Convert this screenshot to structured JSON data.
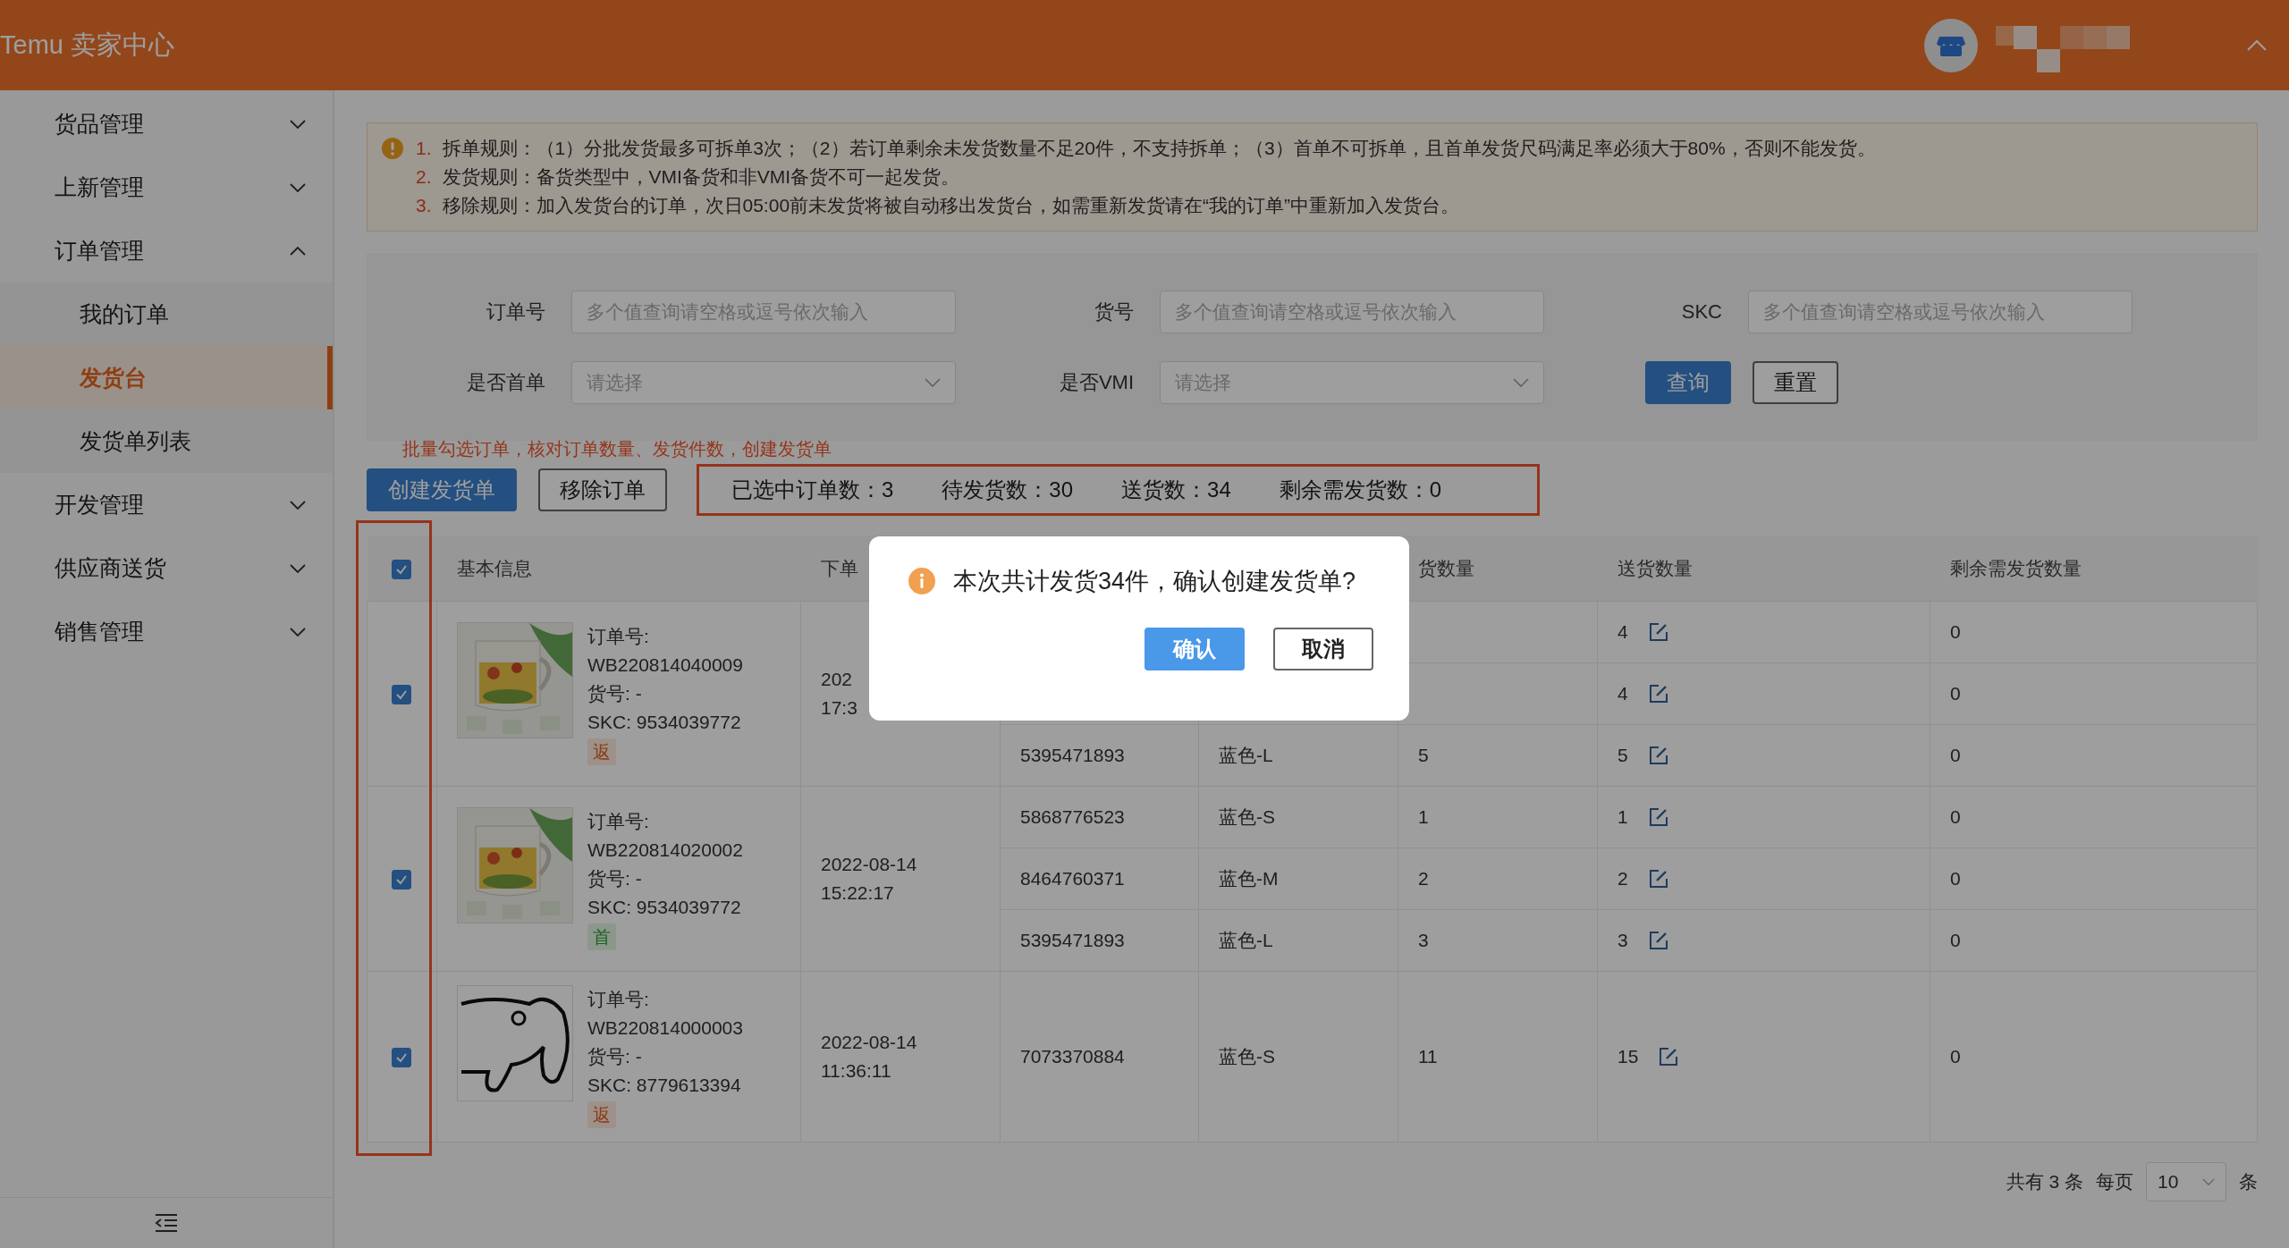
{
  "header": {
    "title": "Temu 卖家中心"
  },
  "sidebar": {
    "items": [
      {
        "label": "货品管理",
        "expanded": false
      },
      {
        "label": "上新管理",
        "expanded": false
      },
      {
        "label": "订单管理",
        "expanded": true,
        "children": [
          {
            "label": "我的订单",
            "selected": false
          },
          {
            "label": "发货台",
            "selected": true
          },
          {
            "label": "发货单列表",
            "selected": false
          }
        ]
      },
      {
        "label": "开发管理",
        "expanded": false
      },
      {
        "label": "供应商送货",
        "expanded": false
      },
      {
        "label": "销售管理",
        "expanded": false
      }
    ]
  },
  "notice": {
    "lines": [
      {
        "number": "1.",
        "text": "拆单规则：（1）分批发货最多可拆单3次；（2）若订单剩余未发货数量不足20件，不支持拆单；（3）首单不可拆单，且首单发货尺码满足率必须大于80%，否则不能发货。"
      },
      {
        "number": "2.",
        "text": "发货规则：备货类型中，VMI备货和非VMI备货不可一起发货。"
      },
      {
        "number": "3.",
        "text": "移除规则：加入发货台的订单，次日05:00前未发货将被自动移出发货台，如需重新发货请在“我的订单”中重新加入发货台。"
      }
    ]
  },
  "filters": {
    "fields": [
      {
        "label": "订单号",
        "kind": "input",
        "placeholder": "多个值查询请空格或逗号依次输入"
      },
      {
        "label": "货号",
        "kind": "input",
        "placeholder": "多个值查询请空格或逗号依次输入"
      },
      {
        "label": "SKC",
        "kind": "input",
        "placeholder": "多个值查询请空格或逗号依次输入"
      },
      {
        "label": "是否首单",
        "kind": "select",
        "placeholder": "请选择"
      },
      {
        "label": "是否VMI",
        "kind": "select",
        "placeholder": "请选择"
      }
    ],
    "buttons": [
      {
        "label": "查询",
        "kind": "primary"
      },
      {
        "label": "重置",
        "kind": "default"
      }
    ]
  },
  "annotation": "批量勾选订单，核对订单数量、发货件数，创建发货单",
  "actions": [
    {
      "label": "创建发货单",
      "kind": "primary"
    },
    {
      "label": "移除订单",
      "kind": "default"
    }
  ],
  "stats": [
    {
      "label": "已选中订单数：",
      "value": "3"
    },
    {
      "label": "待发货数：",
      "value": "30"
    },
    {
      "label": "送货数：",
      "value": "34"
    },
    {
      "label": "剩余需发货数：",
      "value": "0"
    }
  ],
  "table": {
    "select_all_checked": true,
    "columns": [
      {
        "label": "基本信息"
      },
      {
        "label": "下单"
      },
      {},
      {},
      {
        "label": "货数量"
      },
      {
        "label": "送货数量"
      },
      {
        "label": "剩余需发货数量"
      }
    ],
    "orders": [
      {
        "checked": true,
        "order_label": "订单号:",
        "order_no": "WB220814040009",
        "goods_no": "货号: -",
        "skc": "SKC: 9534039772",
        "tag": {
          "text": "返",
          "kind": "return"
        },
        "date": "202",
        "time": "17:3",
        "items": [
          {
            "send": "4",
            "remaining": "0"
          },
          {
            "send": "4",
            "remaining": "0"
          },
          {
            "sku": "5395471893",
            "attr": "蓝色-L",
            "qty": "5",
            "send": "5",
            "remaining": "0"
          }
        ]
      },
      {
        "checked": true,
        "order_label": "订单号:",
        "order_no": "WB220814020002",
        "goods_no": "货号: -",
        "skc": "SKC: 9534039772",
        "tag": {
          "text": "首",
          "kind": "first"
        },
        "date": "2022-08-14",
        "time": "15:22:17",
        "items": [
          {
            "sku": "5868776523",
            "attr": "蓝色-S",
            "qty": "1",
            "send": "1",
            "remaining": "0"
          },
          {
            "sku": "8464760371",
            "attr": "蓝色-M",
            "qty": "2",
            "send": "2",
            "remaining": "0"
          },
          {
            "sku": "5395471893",
            "attr": "蓝色-L",
            "qty": "3",
            "send": "3",
            "remaining": "0"
          }
        ]
      },
      {
        "checked": true,
        "order_label": "订单号:",
        "order_no": "WB220814000003",
        "goods_no": "货号: -",
        "skc": "SKC: 8779613394",
        "tag": {
          "text": "返",
          "kind": "return"
        },
        "date": "2022-08-14",
        "time": "11:36:11",
        "items": [
          {
            "sku": "7073370884",
            "attr": "蓝色-S",
            "qty": "11",
            "send": "15",
            "remaining": "0"
          }
        ]
      }
    ]
  },
  "pagination": {
    "total": "共有 3 条",
    "per_page_label": "每页",
    "per_page": "10",
    "unit": "条"
  },
  "dialog": {
    "message": "本次共计发货34件，确认创建发货单?",
    "buttons": [
      {
        "label": "确认",
        "kind": "primary"
      },
      {
        "label": "取消",
        "kind": "default"
      }
    ]
  }
}
